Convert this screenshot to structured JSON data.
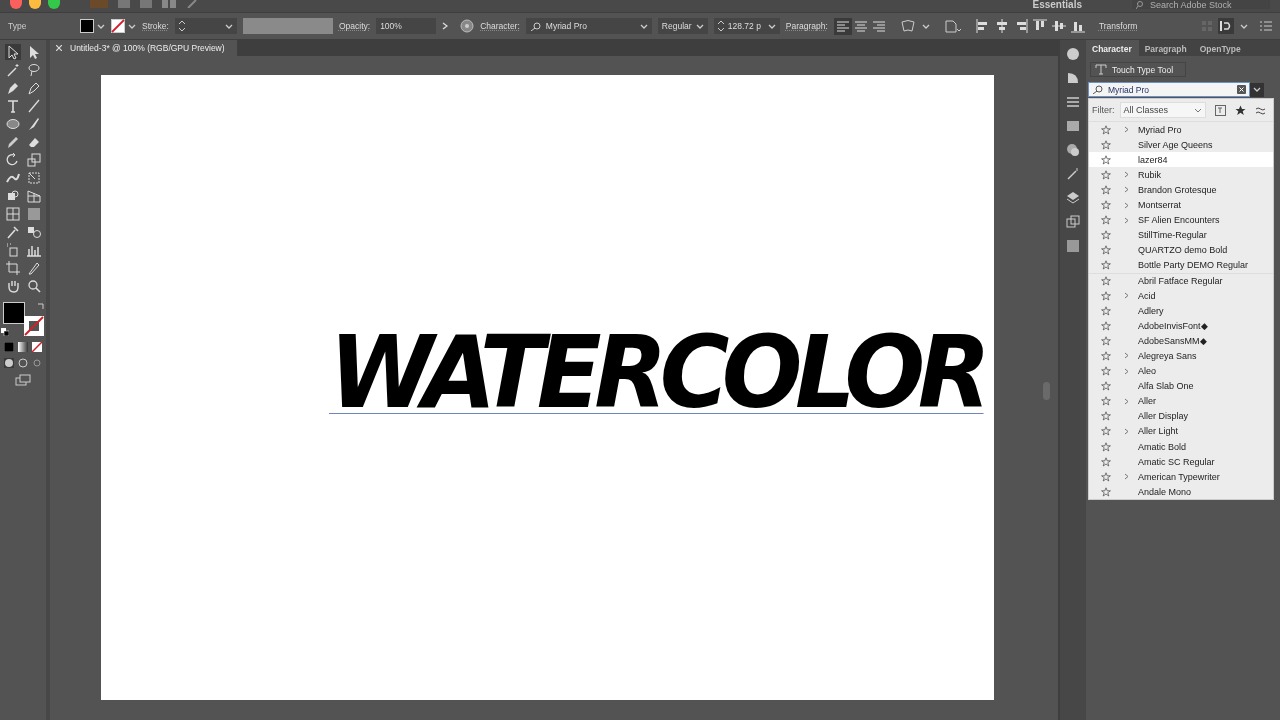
{
  "window": {
    "workspace": "Essentials",
    "stock_search": {
      "placeholder": "Search Adobe Stock"
    },
    "document_tab": "Untitled-3* @ 100% (RGB/GPU Preview)"
  },
  "control_bar": {
    "tool": "Type",
    "stroke_label": "Stroke:",
    "opacity_label": "Opacity:",
    "opacity": "100%",
    "character_label": "Character:",
    "font": "Myriad Pro",
    "style": "Regular",
    "size": "128.72 p",
    "paragraph_label": "Paragraph:",
    "align": [
      {
        "selected": true
      },
      {
        "selected": false
      },
      {
        "selected": false
      }
    ],
    "transform": "Transform"
  },
  "artboard": {
    "text": "WATERCOLOR"
  },
  "panel": {
    "tabs": [
      {
        "label": "Character",
        "selected": true
      },
      {
        "label": "Paragraph",
        "selected": false
      },
      {
        "label": "OpenType",
        "selected": false
      }
    ],
    "touch_type": "Touch Type Tool",
    "font_search": {
      "value": "Myriad Pro"
    },
    "filter_label": "Filter:",
    "filter": "All Classes",
    "recent_fonts": [
      {
        "name": "Myriad Pro",
        "expandable": true,
        "selected": false
      },
      {
        "name": "Silver Age Queens",
        "expandable": false,
        "selected": false
      },
      {
        "name": "lazer84",
        "expandable": false,
        "selected": true
      },
      {
        "name": "Rubik",
        "expandable": true,
        "selected": false
      },
      {
        "name": "Brandon Grotesque",
        "expandable": true,
        "selected": false
      },
      {
        "name": "Montserrat",
        "expandable": true,
        "selected": false
      },
      {
        "name": "SF Alien Encounters",
        "expandable": true,
        "selected": false
      },
      {
        "name": "StillTime-Regular",
        "expandable": false,
        "selected": false
      },
      {
        "name": "QUARTZO demo Bold",
        "expandable": false,
        "selected": false
      },
      {
        "name": "Bottle Party DEMO Regular",
        "expandable": false,
        "selected": false
      }
    ],
    "fonts": [
      {
        "name": "Abril Fatface Regular",
        "expandable": false,
        "selected": false
      },
      {
        "name": "Acid",
        "expandable": true,
        "selected": false
      },
      {
        "name": "Adlery",
        "expandable": false,
        "selected": false
      },
      {
        "name": "AdobeInvisFont◆",
        "expandable": false,
        "selected": false
      },
      {
        "name": "AdobeSansMM◆",
        "expandable": false,
        "selected": false
      },
      {
        "name": "Alegreya Sans",
        "expandable": true,
        "selected": false
      },
      {
        "name": "Aleo",
        "expandable": true,
        "selected": false
      },
      {
        "name": "Alfa Slab One",
        "expandable": false,
        "selected": false
      },
      {
        "name": "Aller",
        "expandable": true,
        "selected": false
      },
      {
        "name": "Aller Display",
        "expandable": false,
        "selected": false
      },
      {
        "name": "Aller Light",
        "expandable": true,
        "selected": false
      },
      {
        "name": "Amatic Bold",
        "expandable": false,
        "selected": false
      },
      {
        "name": "Amatic SC Regular",
        "expandable": false,
        "selected": false
      },
      {
        "name": "American Typewriter",
        "expandable": true,
        "selected": false
      },
      {
        "name": "Andale Mono",
        "expandable": false,
        "selected": false
      }
    ]
  }
}
